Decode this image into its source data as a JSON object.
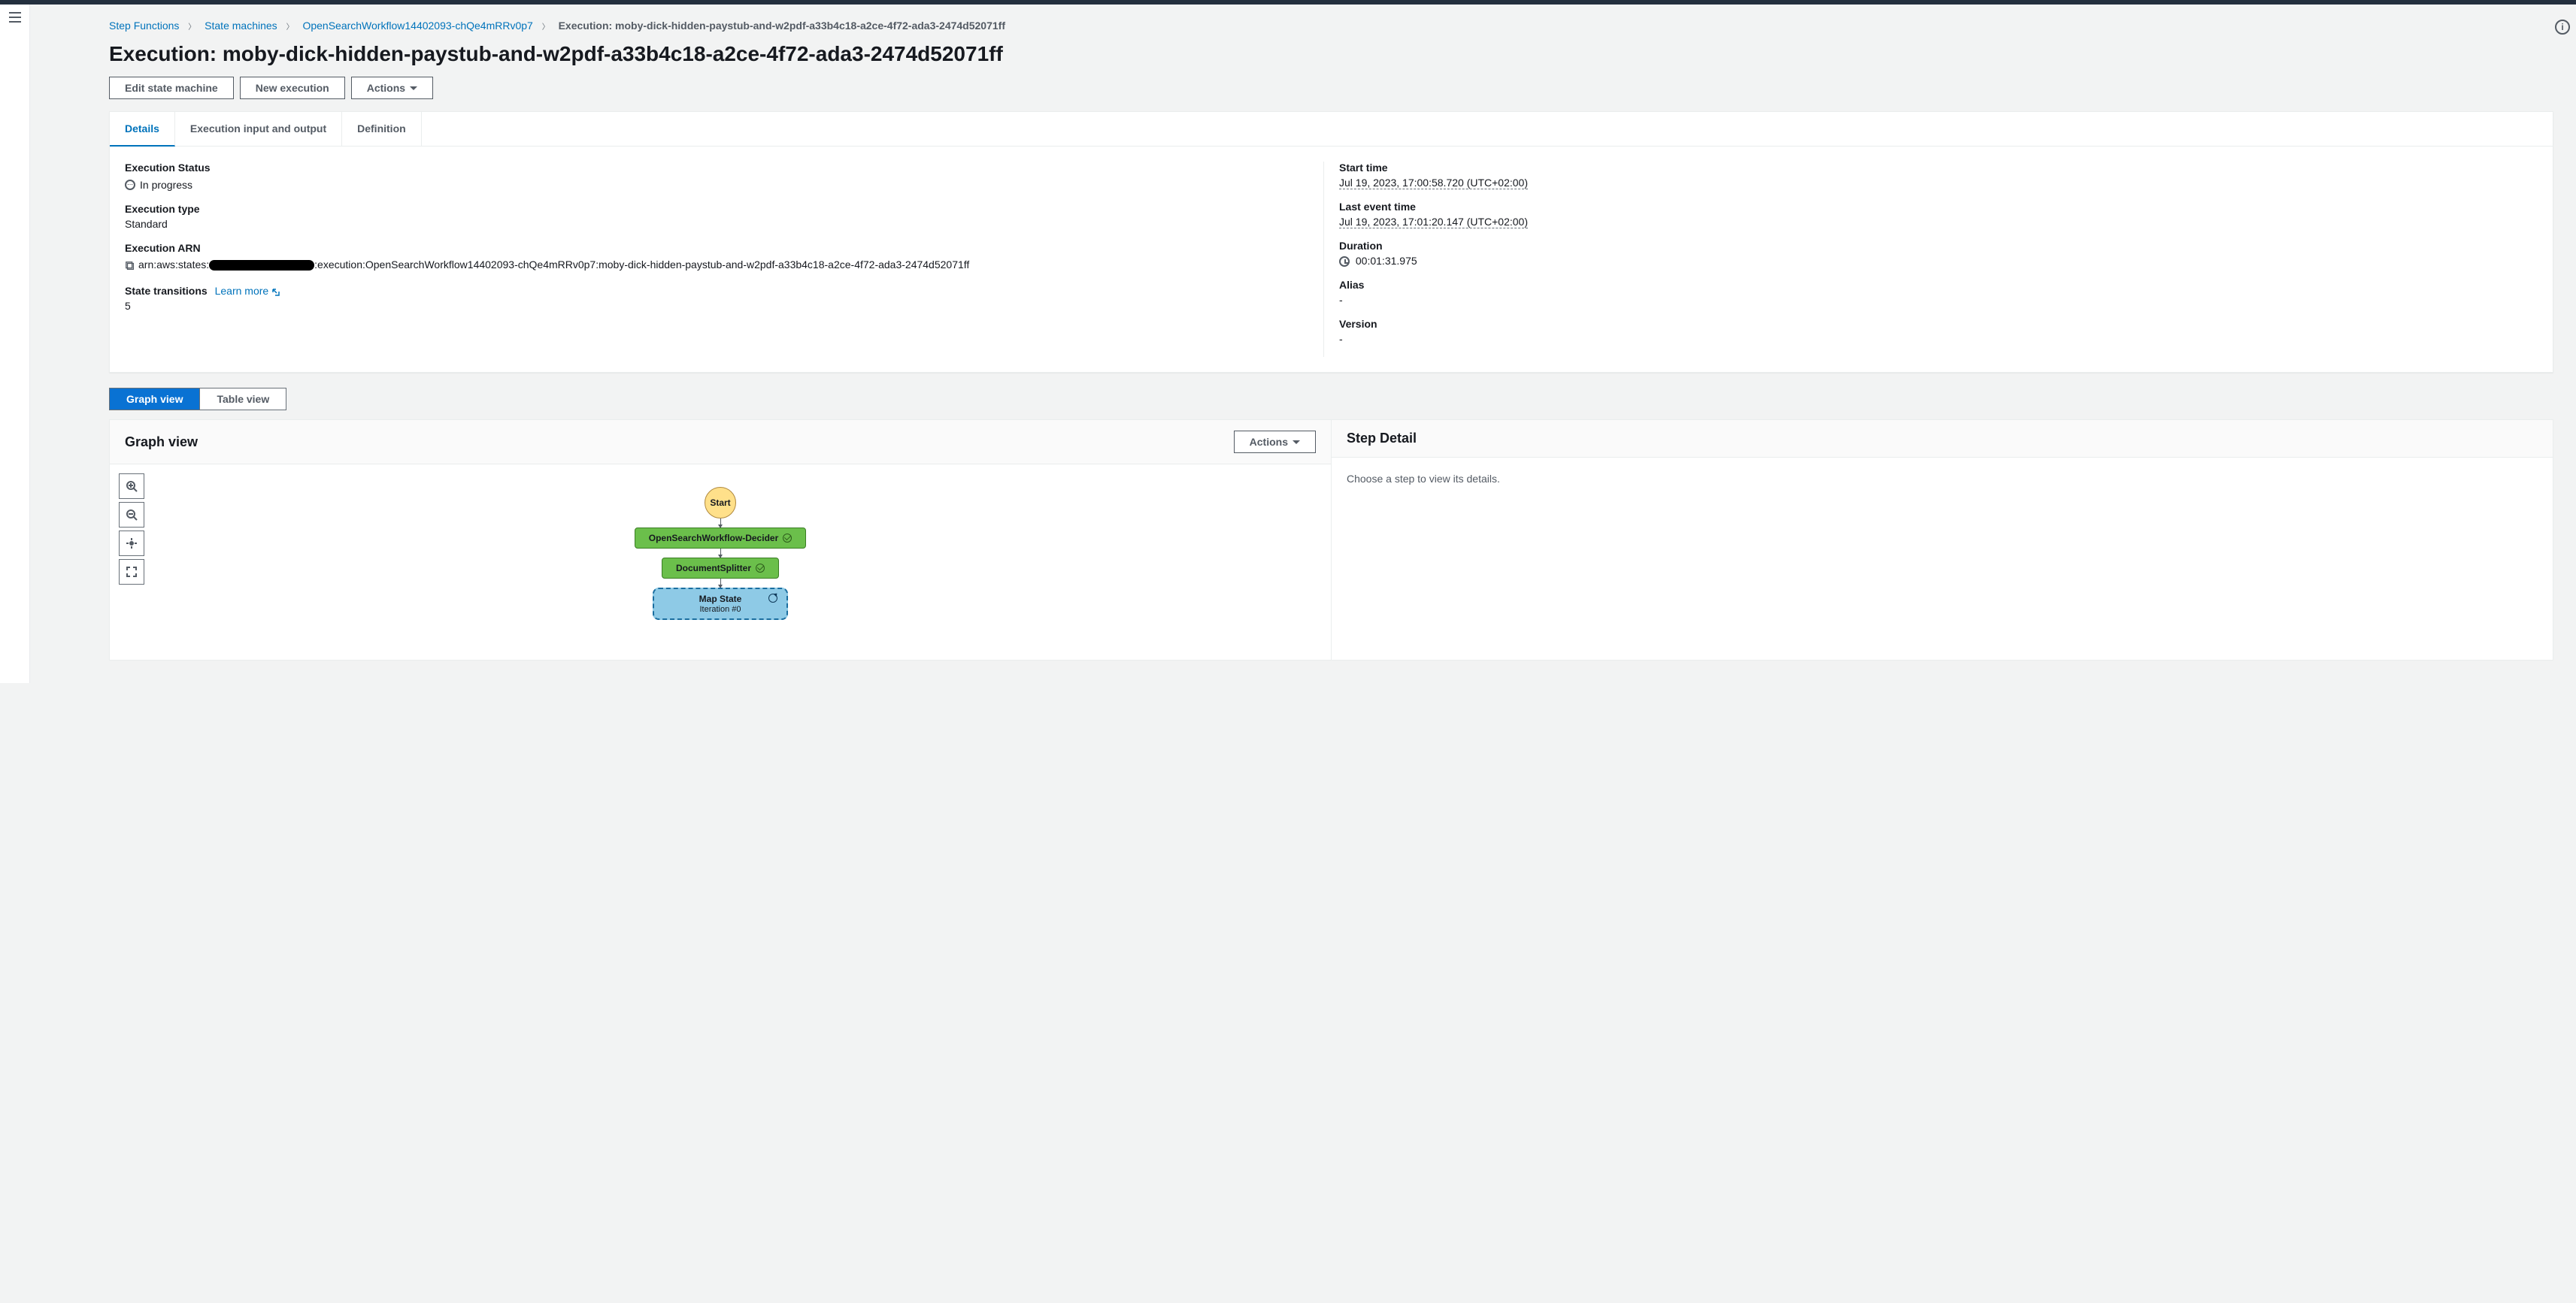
{
  "breadcrumbs": {
    "items": [
      {
        "label": "Step Functions"
      },
      {
        "label": "State machines"
      },
      {
        "label": "OpenSearchWorkflow14402093-chQe4mRRv0p7"
      }
    ],
    "current": "Execution: moby-dick-hidden-paystub-and-w2pdf-a33b4c18-a2ce-4f72-ada3-2474d52071ff"
  },
  "page_title": "Execution: moby-dick-hidden-paystub-and-w2pdf-a33b4c18-a2ce-4f72-ada3-2474d52071ff",
  "buttons": {
    "edit": "Edit state machine",
    "new_exec": "New execution",
    "actions": "Actions"
  },
  "tabs": {
    "details": "Details",
    "io": "Execution input and output",
    "definition": "Definition"
  },
  "details": {
    "left": {
      "status_label": "Execution Status",
      "status_value": "In progress",
      "type_label": "Execution type",
      "type_value": "Standard",
      "arn_label": "Execution ARN",
      "arn_prefix": "arn:aws:states:",
      "arn_suffix": ":execution:OpenSearchWorkflow14402093-chQe4mRRv0p7:moby-dick-hidden-paystub-and-w2pdf-a33b4c18-a2ce-4f72-ada3-2474d52071ff",
      "transitions_label": "State transitions",
      "learn_more": "Learn more",
      "transitions_value": "5"
    },
    "right": {
      "start_label": "Start time",
      "start_value": "Jul 19, 2023, 17:00:58.720 (UTC+02:00)",
      "last_label": "Last event time",
      "last_value": "Jul 19, 2023, 17:01:20.147 (UTC+02:00)",
      "duration_label": "Duration",
      "duration_value": "00:01:31.975",
      "alias_label": "Alias",
      "alias_value": "-",
      "version_label": "Version",
      "version_value": "-"
    }
  },
  "view_toggle": {
    "graph": "Graph view",
    "table": "Table view"
  },
  "graph_panel": {
    "title": "Graph view",
    "actions": "Actions",
    "nodes": {
      "start": "Start",
      "decider": "OpenSearchWorkflow-Decider",
      "splitter": "DocumentSplitter",
      "map_title": "Map State",
      "map_sub": "Iteration #0"
    }
  },
  "detail_panel": {
    "title": "Step Detail",
    "empty": "Choose a step to view its details."
  }
}
